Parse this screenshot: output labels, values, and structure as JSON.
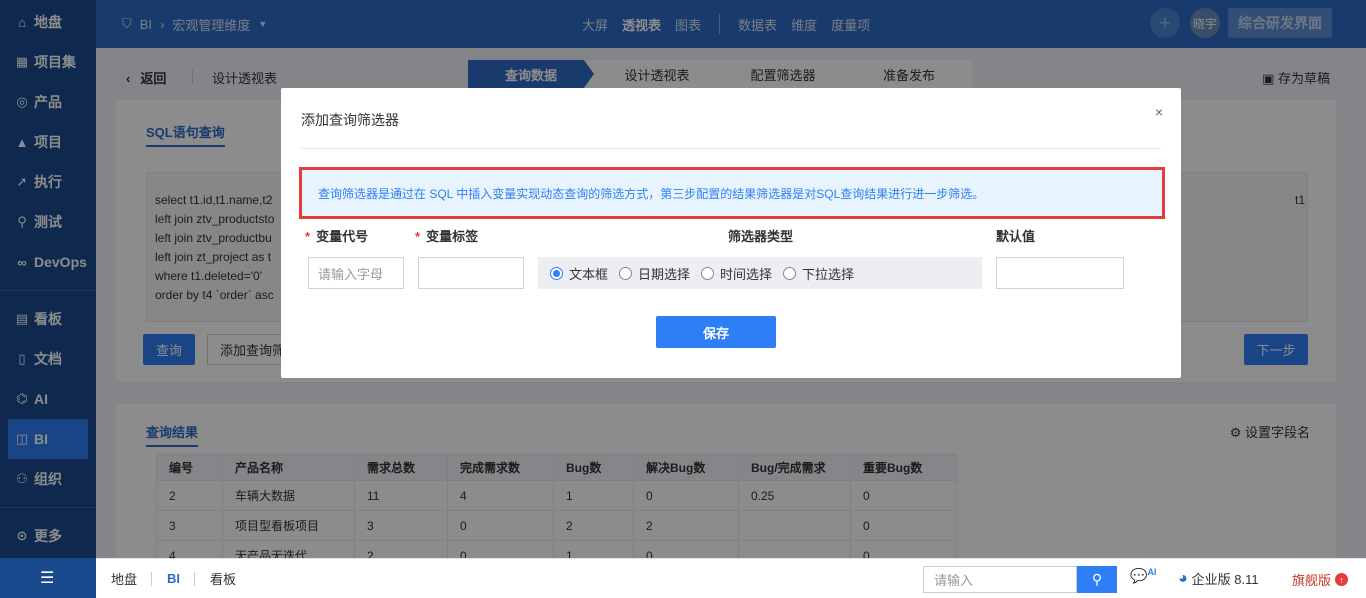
{
  "sidebar": {
    "items": [
      {
        "label": "地盘",
        "icon": "home-icon"
      },
      {
        "label": "项目集",
        "icon": "grid-icon"
      },
      {
        "label": "产品",
        "icon": "bulb-icon"
      },
      {
        "label": "项目",
        "icon": "rocket-icon"
      },
      {
        "label": "执行",
        "icon": "run-icon"
      },
      {
        "label": "测试",
        "icon": "search-icon"
      },
      {
        "label": "DevOps",
        "icon": "infinity-icon"
      },
      {
        "label": "看板",
        "icon": "board-icon"
      },
      {
        "label": "文档",
        "icon": "doc-icon"
      },
      {
        "label": "AI",
        "icon": "robot-icon"
      },
      {
        "label": "BI",
        "icon": "chart-icon"
      },
      {
        "label": "组织",
        "icon": "people-icon"
      },
      {
        "label": "更多",
        "icon": "more-icon"
      }
    ],
    "active": "BI"
  },
  "topbar": {
    "breadcrumb_root": "BI",
    "breadcrumb_current": "宏观管理维度",
    "nav": [
      "大屏",
      "透视表",
      "图表",
      "数据表",
      "维度",
      "度量项"
    ],
    "nav_active": "透视表",
    "avatar": "晓宇",
    "brand_button": "综合研发界面"
  },
  "subheader": {
    "back": "返回",
    "title": "设计透视表",
    "steps": [
      "查询数据",
      "设计透视表",
      "配置筛选器",
      "准备发布"
    ],
    "active_step": "查询数据",
    "save_draft": "存为草稿"
  },
  "query_panel": {
    "tab": "SQL语句查询",
    "sql_lines": [
      "select t1.id,t1.name,t2",
      "left join ztv_productsto",
      "left join ztv_productbu",
      "left join zt_project as t",
      "where t1.deleted='0'",
      "order by t4 `order` asc"
    ],
    "sql_tail": "t1",
    "query_button": "查询",
    "add_filter_button": "添加查询筛",
    "next_button": "下一步"
  },
  "result_panel": {
    "tab": "查询结果",
    "set_field_name": "设置字段名",
    "columns": [
      "编号",
      "产品名称",
      "需求总数",
      "完成需求数",
      "Bug数",
      "解决Bug数",
      "Bug/完成需求",
      "重要Bug数"
    ],
    "rows": [
      [
        "2",
        "车辆大数据",
        "11",
        "4",
        "1",
        "0",
        "0.25",
        "0"
      ],
      [
        "3",
        "项目型看板项目",
        "3",
        "0",
        "2",
        "2",
        "",
        "0"
      ],
      [
        "4",
        "无产品无迭代",
        "2",
        "0",
        "1",
        "0",
        "",
        "0"
      ]
    ]
  },
  "bottombar": {
    "tabs": [
      "地盘",
      "BI",
      "看板"
    ],
    "active": "BI",
    "search_placeholder": "请输入",
    "ai_badge": "AI",
    "edition": "企业版 8.11",
    "flagship": "旗舰版"
  },
  "modal": {
    "title": "添加查询筛选器",
    "close": "×",
    "info": "查询筛选器是通过在 SQL 中插入变量实现动态查询的筛选方式，第三步配置的结果筛选器是对SQL查询结果进行进一步筛选。",
    "var_code_label": "变量代号",
    "var_label_label": "变量标签",
    "filter_type_label": "筛选器类型",
    "default_label": "默认值",
    "var_code_placeholder": "请输入字母",
    "filter_types": [
      "文本框",
      "日期选择",
      "时间选择",
      "下拉选择"
    ],
    "filter_type_selected": "文本框",
    "save_button": "保存"
  }
}
